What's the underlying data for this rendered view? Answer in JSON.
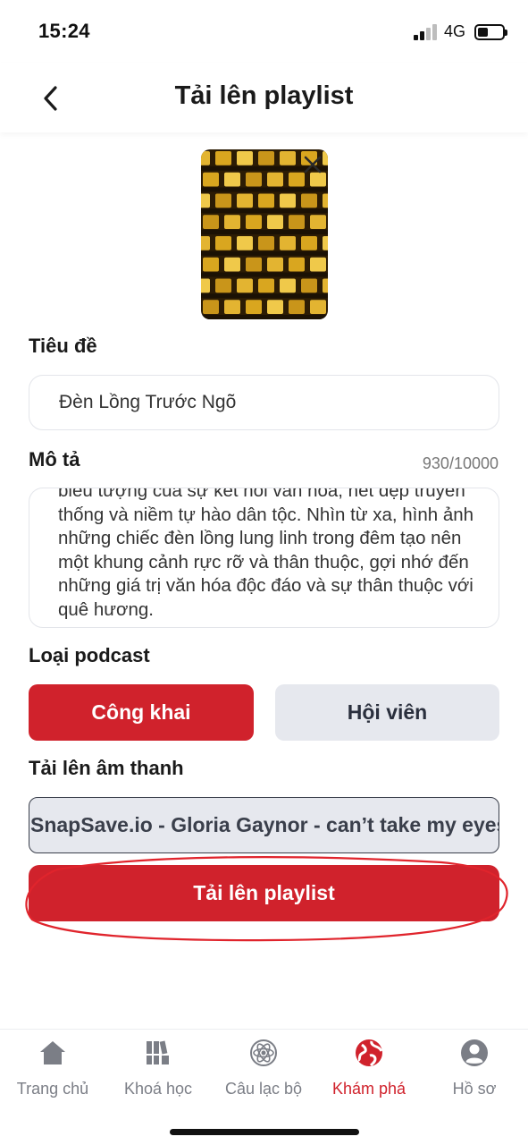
{
  "status_bar": {
    "time": "15:24",
    "network": "4G"
  },
  "header": {
    "title": "Tải lên playlist",
    "back_icon": "chevron-left-icon"
  },
  "cover": {
    "close_icon": "close-icon"
  },
  "title_field": {
    "label": "Tiêu đề",
    "value": "Đèn Lồng Trước Ngõ"
  },
  "description": {
    "label": "Mô tả",
    "counter": "930/10000",
    "value": "biểu tượng của sự kết nối văn hóa, nét đẹp truyền thống và niềm tự hào dân tộc. Nhìn từ xa, hình ảnh những chiếc đèn lồng lung linh trong đêm tạo nên một khung cảnh rực rỡ và thân thuộc, gợi nhớ đến những giá trị văn hóa độc đáo và sự thân thuộc với quê hương."
  },
  "podcast_type": {
    "label": "Loại podcast",
    "options": [
      "Công khai",
      "Hội viên"
    ],
    "selected": "Công khai"
  },
  "audio": {
    "label": "Tải lên âm thanh",
    "file_name": "SnapSave.io - Gloria Gaynor - can’t take my eyes off you"
  },
  "submit": {
    "label": "Tải lên playlist"
  },
  "bottom_nav": {
    "items": [
      {
        "label": "Trang chủ",
        "icon": "home-icon"
      },
      {
        "label": "Khoá học",
        "icon": "books-icon"
      },
      {
        "label": "Câu lạc bộ",
        "icon": "atom-icon"
      },
      {
        "label": "Khám phá",
        "icon": "explore-globe-icon"
      },
      {
        "label": "Hồ sơ",
        "icon": "profile-icon"
      }
    ],
    "active": "Khám phá"
  },
  "colors": {
    "accent": "#d0222c",
    "secondary_bg": "#e6e8ee",
    "nav_inactive": "#7b7e86"
  }
}
